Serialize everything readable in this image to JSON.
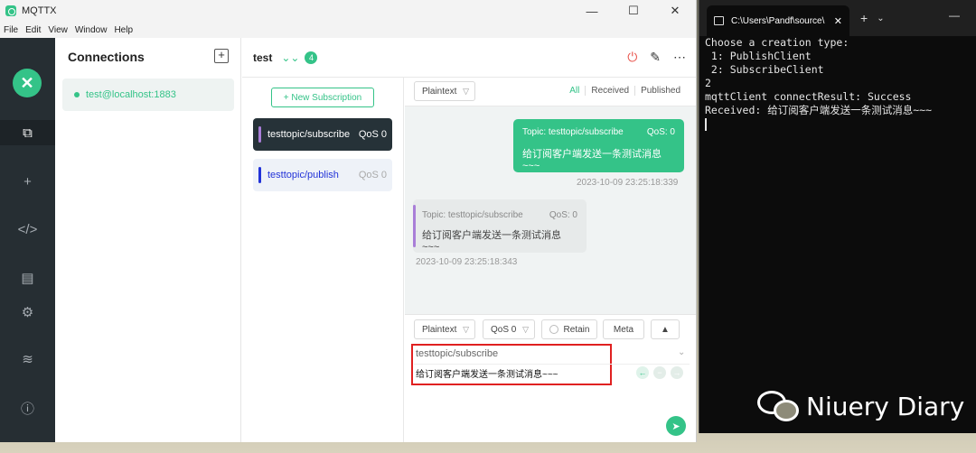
{
  "app": {
    "title": "MQTTX",
    "menu": [
      "File",
      "Edit",
      "View",
      "Window",
      "Help"
    ]
  },
  "window_controls": {
    "minimize": "—",
    "maximize": "☐",
    "close": "✕"
  },
  "sidebar": {
    "logo": "✕",
    "icons": [
      "connections-icon",
      "add-icon",
      "script-icon",
      "log-icon",
      "settings-icon",
      "feed-icon",
      "about-icon"
    ]
  },
  "connections": {
    "header": "Connections",
    "add": "+",
    "items": [
      {
        "label": "test@localhost:1883",
        "status_color": "#34c388"
      }
    ]
  },
  "connection": {
    "name": "test",
    "badge": "4"
  },
  "subscriptions": {
    "new_label": "+ New Subscription",
    "items": [
      {
        "topic": "testtopic/subscribe",
        "qos": "QoS 0",
        "color": "#a97ed8",
        "selected": true
      },
      {
        "topic": "testtopic/publish",
        "qos": "QoS 0",
        "color": "#2233d8",
        "selected": false
      }
    ]
  },
  "messages": {
    "format": "Plaintext",
    "filters": [
      "All",
      "Received",
      "Published"
    ],
    "items": [
      {
        "direction": "out",
        "topic": "Topic: testtopic/subscribe",
        "qos": "QoS: 0",
        "payload": "给订阅客户端发送一条测试消息~~~",
        "time": "2023-10-09 23:25:18:339"
      },
      {
        "direction": "in",
        "topic": "Topic: testtopic/subscribe",
        "qos": "QoS: 0",
        "payload": "给订阅客户端发送一条测试消息~~~",
        "time": "2023-10-09 23:25:18:343"
      }
    ]
  },
  "composer": {
    "format": "Plaintext",
    "qos": "QoS 0",
    "retain": "Retain",
    "meta": "Meta",
    "topic": "testtopic/subscribe",
    "payload": "给订阅客户端发送一条测试消息~~~"
  },
  "terminal": {
    "tab_title": "C:\\Users\\Pandf\\source\\",
    "lines": [
      "Choose a creation type:",
      " 1: PublishClient",
      " 2: SubscribeClient",
      "2",
      "mqttClient connectResult: Success",
      "Received: 给订阅客户端发送一条测试消息~~~"
    ]
  },
  "watermark": {
    "text": "Niuery Diary"
  }
}
